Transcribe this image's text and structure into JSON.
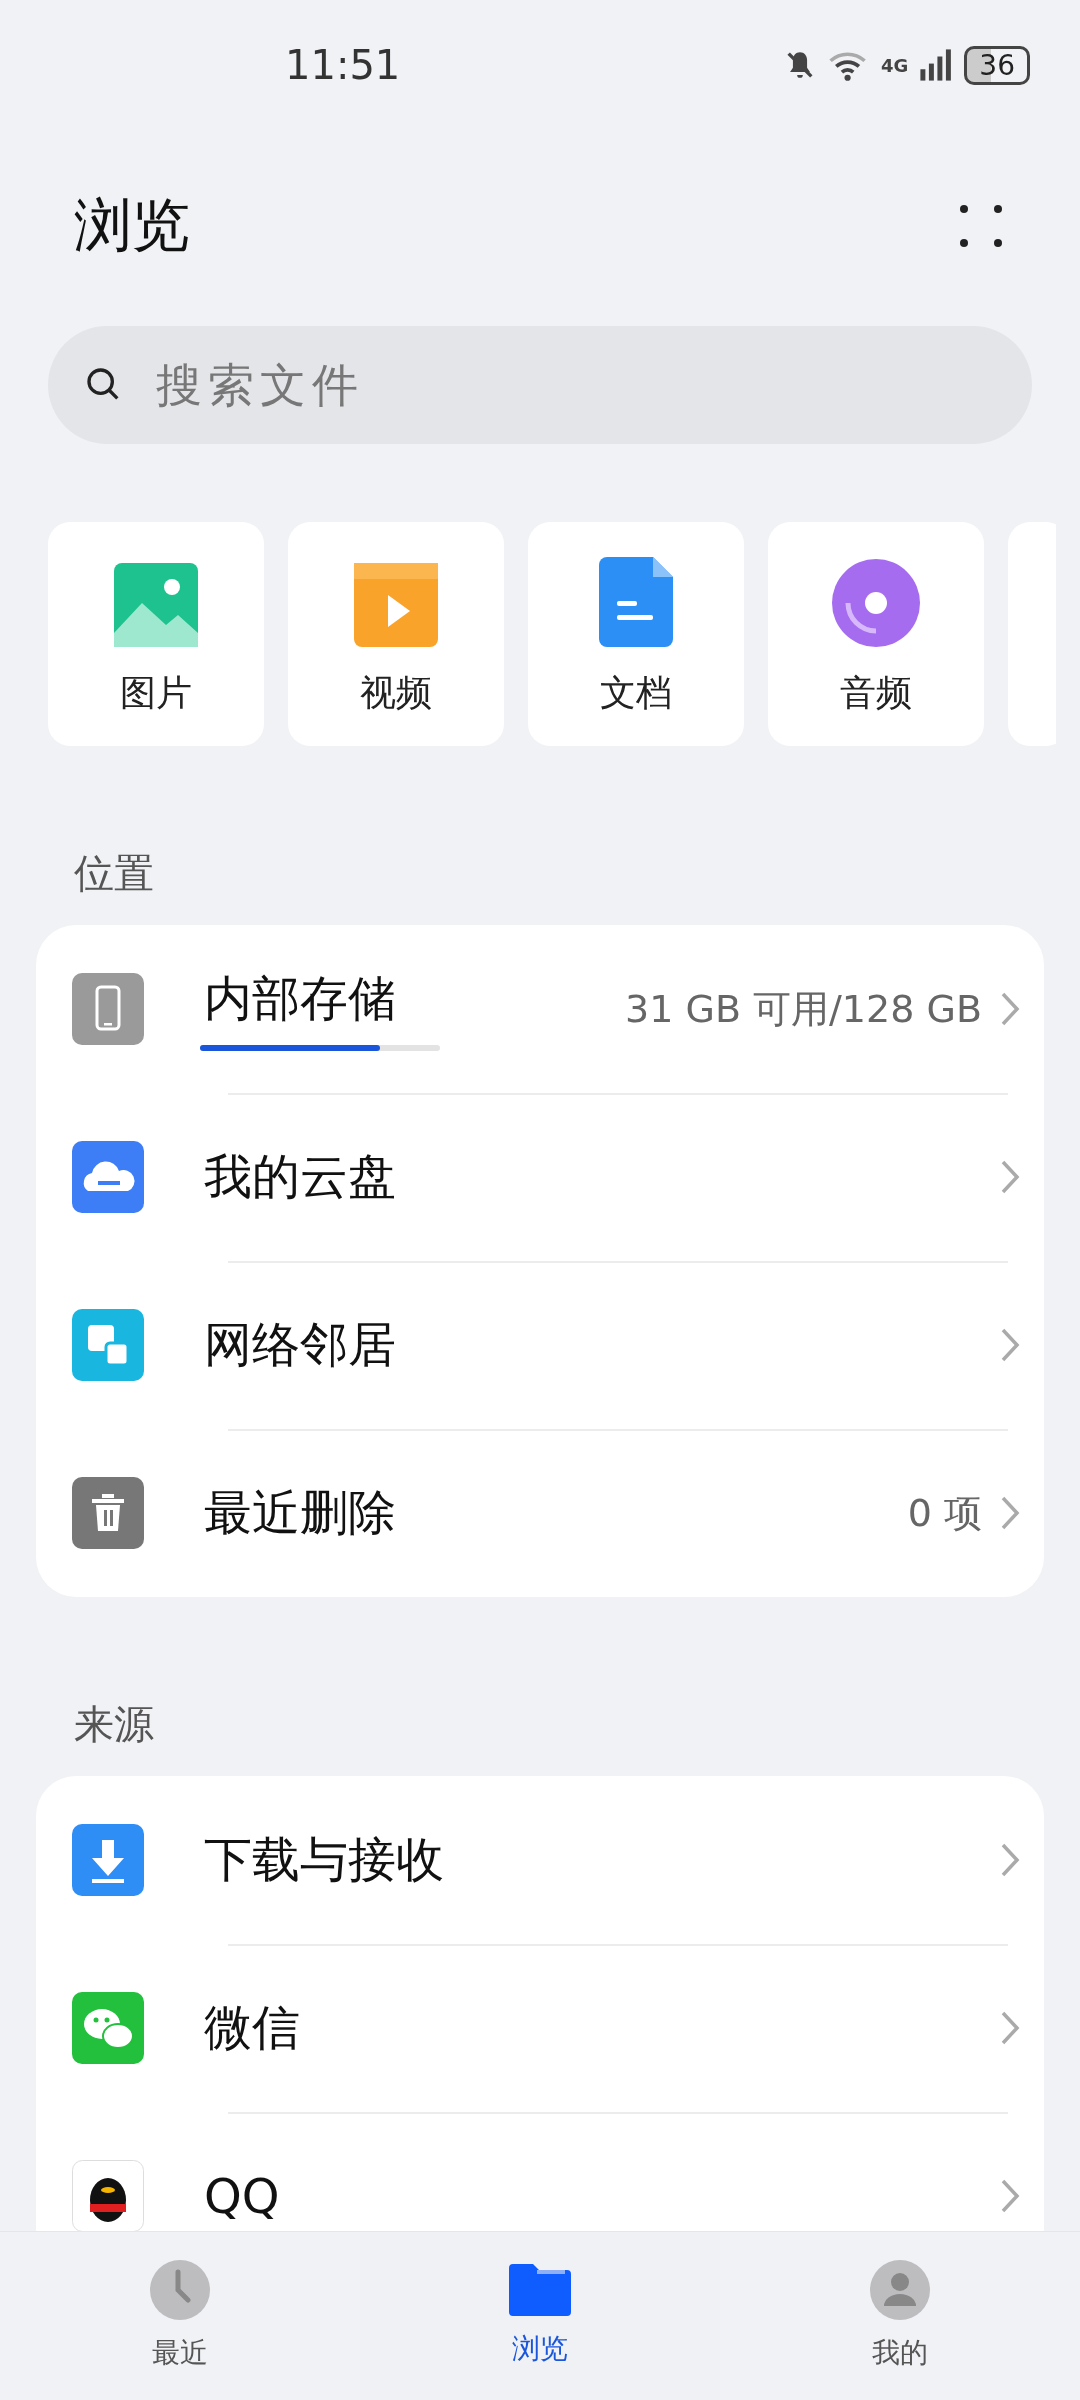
{
  "status_bar": {
    "time": "11:51",
    "battery": "36",
    "network": "4G"
  },
  "header": {
    "title": "浏览"
  },
  "search": {
    "placeholder": "搜索文件"
  },
  "categories": [
    {
      "kind": "image",
      "label": "图片"
    },
    {
      "kind": "video",
      "label": "视频"
    },
    {
      "kind": "doc",
      "label": "文档"
    },
    {
      "kind": "audio",
      "label": "音频"
    }
  ],
  "sections": [
    {
      "title": "位置",
      "rows": [
        {
          "kind": "phone",
          "label": "内部存储",
          "detail": "31 GB 可用/128 GB",
          "level": 0.75
        },
        {
          "kind": "cloud",
          "label": "我的云盘"
        },
        {
          "kind": "network",
          "label": "网络邻居"
        },
        {
          "kind": "trash",
          "label": "最近删除",
          "detail": "0 项"
        }
      ]
    },
    {
      "title": "来源",
      "rows": [
        {
          "kind": "download",
          "label": "下载与接收"
        },
        {
          "kind": "chat",
          "label": "微信"
        },
        {
          "kind": "bird",
          "label": "QQ"
        }
      ]
    }
  ],
  "tabs": [
    {
      "kind": "recent",
      "label": "最近",
      "selected": false
    },
    {
      "kind": "browse",
      "label": "浏览",
      "selected": true
    },
    {
      "kind": "me",
      "label": "我的",
      "selected": false
    }
  ]
}
